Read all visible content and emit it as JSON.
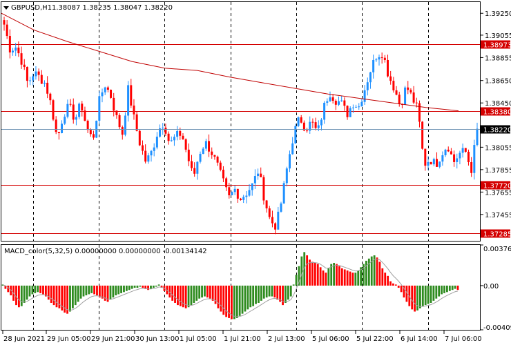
{
  "main_header": {
    "symbol_label": "GBPUSD,H1",
    "ohlc_values": "1.38087 1.38235 1.38047 1.38220"
  },
  "macd_header": "MACD_color(5,32,5) 0.00000000 0.00000000 -0.00134142",
  "colors": {
    "bull": "#2e8b1f",
    "bear": "#ff0000",
    "candle_up": "#1e90ff",
    "candle_down": "#ff0000",
    "ma_line": "#c00000",
    "level_line": "#d40000",
    "current_price_line": "#6f93b4",
    "signal_line": "#a0a0a0"
  },
  "chart_data": [
    {
      "type": "candlestick",
      "y_ticks": [
        "1.39250",
        "1.39055",
        "1.38855",
        "1.38650",
        "1.38450",
        "1.38055",
        "1.37855",
        "1.37655",
        "1.37455"
      ],
      "ylim": [
        1.3722,
        1.3935
      ],
      "levels": [
        {
          "label": "1.38973",
          "value": 1.38973
        },
        {
          "label": "1.38380",
          "value": 1.3838
        },
        {
          "label": "1.37720",
          "value": 1.3772
        },
        {
          "label": "1.37285",
          "value": 1.37285
        }
      ],
      "current_price": {
        "label": "1.38220",
        "value": 1.3822
      },
      "price_path": [
        1.3915,
        1.3893,
        1.3895,
        1.3882,
        1.3862,
        1.3872,
        1.3868,
        1.3862,
        1.3842,
        1.3812,
        1.3835,
        1.3842,
        1.383,
        1.3845,
        1.3822,
        1.3812,
        1.3845,
        1.3862,
        1.3852,
        1.3832,
        1.3818,
        1.3858,
        1.383,
        1.3808,
        1.3792,
        1.3802,
        1.382,
        1.3828,
        1.3808,
        1.3815,
        1.3818,
        1.3798,
        1.3778,
        1.38,
        1.381,
        1.3802,
        1.379,
        1.3775,
        1.376,
        1.3768,
        1.376,
        1.3765,
        1.3772,
        1.3785,
        1.376,
        1.374,
        1.3735,
        1.376,
        1.3792,
        1.3818,
        1.3832,
        1.3822,
        1.3828,
        1.3818,
        1.384,
        1.3855,
        1.3848,
        1.3845,
        1.3835,
        1.3845,
        1.3842,
        1.3858,
        1.3875,
        1.3888,
        1.389,
        1.387,
        1.3858,
        1.3842,
        1.386,
        1.385,
        1.3838,
        1.379,
        1.3795,
        1.379,
        1.38,
        1.3808,
        1.3792,
        1.38,
        1.3802,
        1.3785,
        1.3822
      ],
      "ma_path": [
        1.3925,
        1.391,
        1.39,
        1.3891,
        1.3882,
        1.3876,
        1.3874,
        1.3868,
        1.3863,
        1.3858,
        1.3853,
        1.3849,
        1.3845,
        1.3841,
        1.3838
      ],
      "x_tick_labels": [
        "28 Jun 2021",
        "29 Jun 05:00",
        "29 Jun 21:00",
        "30 Jun 13:00",
        "1 Jul 05:00",
        "1 Jul 21:00",
        "2 Jul 13:00",
        "5 Jul 06:00",
        "5 Jul 22:00",
        "6 Jul 14:00",
        "7 Jul 06:00"
      ]
    },
    {
      "type": "histogram",
      "y_ticks": [
        "0.0037620",
        "0.00",
        "-0.004091"
      ],
      "ylim": [
        -0.004091,
        0.003762
      ],
      "values": [
        0.0001,
        -0.0003,
        -0.0006,
        -0.0009,
        -0.0014,
        -0.0018,
        -0.002,
        -0.0019,
        -0.0016,
        -0.0013,
        -0.001,
        -0.0008,
        -0.0007,
        -0.0006,
        -0.0007,
        -0.0008,
        -0.001,
        -0.0013,
        -0.0016,
        -0.0018,
        -0.002,
        -0.0021,
        -0.0023,
        -0.0025,
        -0.0026,
        -0.0024,
        -0.0021,
        -0.0018,
        -0.0015,
        -0.0012,
        -0.001,
        -0.0009,
        -0.0008,
        -0.0007,
        -0.0008,
        -0.0009,
        -0.0011,
        -0.0012,
        -0.0014,
        -0.0015,
        -0.0013,
        -0.0011,
        -0.0009,
        -0.0008,
        -0.0007,
        -0.0006,
        -0.0005,
        -0.0004,
        -0.0003,
        -0.0002,
        -0.0002,
        -0.0001,
        -0.0002,
        -0.0003,
        -0.0004,
        -0.0003,
        -0.0002,
        -0.0001,
        0.0001,
        -0.0002,
        -0.0005,
        -0.0008,
        -0.0011,
        -0.0014,
        -0.0016,
        -0.0018,
        -0.0019,
        -0.002,
        -0.0021,
        -0.002,
        -0.0018,
        -0.0016,
        -0.0014,
        -0.0012,
        -0.0011,
        -0.001,
        -0.0011,
        -0.0012,
        -0.0014,
        -0.0017,
        -0.0021,
        -0.0024,
        -0.0027,
        -0.0029,
        -0.003,
        -0.0031,
        -0.0031,
        -0.003,
        -0.0028,
        -0.0026,
        -0.0024,
        -0.0022,
        -0.002,
        -0.0019,
        -0.0017,
        -0.0016,
        -0.0014,
        -0.0012,
        -0.0011,
        -0.001,
        -0.001,
        -0.0011,
        -0.0013,
        -0.0015,
        -0.0018,
        -0.0016,
        -0.0013,
        -0.001,
        0.0001,
        0.001,
        0.0018,
        0.0027,
        0.0031,
        0.0028,
        0.0024,
        0.0022,
        0.0021,
        0.002,
        0.0017,
        0.0014,
        0.0012,
        0.0016,
        0.002,
        0.0021,
        0.002,
        0.0018,
        0.0016,
        0.0015,
        0.0014,
        0.0013,
        0.0012,
        0.0012,
        0.0014,
        0.0017,
        0.002,
        0.0023,
        0.0025,
        0.0027,
        0.0028,
        0.0026,
        0.0022,
        0.0016,
        0.0012,
        0.0009,
        0.0004,
        0.0002,
        0.0001,
        -0.0002,
        -0.0006,
        -0.0011,
        -0.0015,
        -0.0019,
        -0.0022,
        -0.0024,
        -0.0023,
        -0.0021,
        -0.0019,
        -0.0018,
        -0.0017,
        -0.0016,
        -0.0014,
        -0.0012,
        -0.001,
        -0.0008,
        -0.0007,
        -0.0006,
        -0.0005,
        -0.0004,
        -0.0003,
        -0.0004
      ]
    }
  ]
}
